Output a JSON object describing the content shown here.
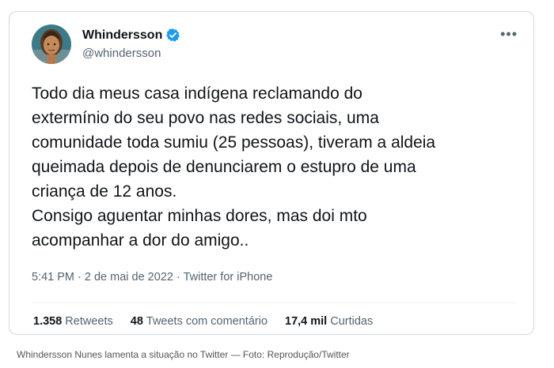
{
  "tweet": {
    "display_name": "Whindersson",
    "username": "@whindersson",
    "text": "Todo dia meus casa indígena reclamando do\nextermínio do seu povo nas redes sociais, uma\ncomunidade toda sumiu (25 pessoas), tiveram a aldeia\nqueimada depois de denunciarem o estupro de uma\ncriança de 12 anos.\nConsigo aguentar minhas dores, mas doi mto\nacompanhar a dor do amigo..",
    "meta": "5:41 PM · 2 de mai de 2022 · Twitter for iPhone",
    "stats": [
      {
        "value": "1.358",
        "label": "Retweets"
      },
      {
        "value": "48",
        "label": "Tweets com comentário"
      },
      {
        "value": "17,4 mil",
        "label": "Curtidas"
      }
    ],
    "verified_color": "#1d9bf0",
    "more_icon": "more-horizontal-icon"
  },
  "caption": "Whindersson Nunes lamenta a situação no Twitter — Foto: Reprodução/Twitter"
}
